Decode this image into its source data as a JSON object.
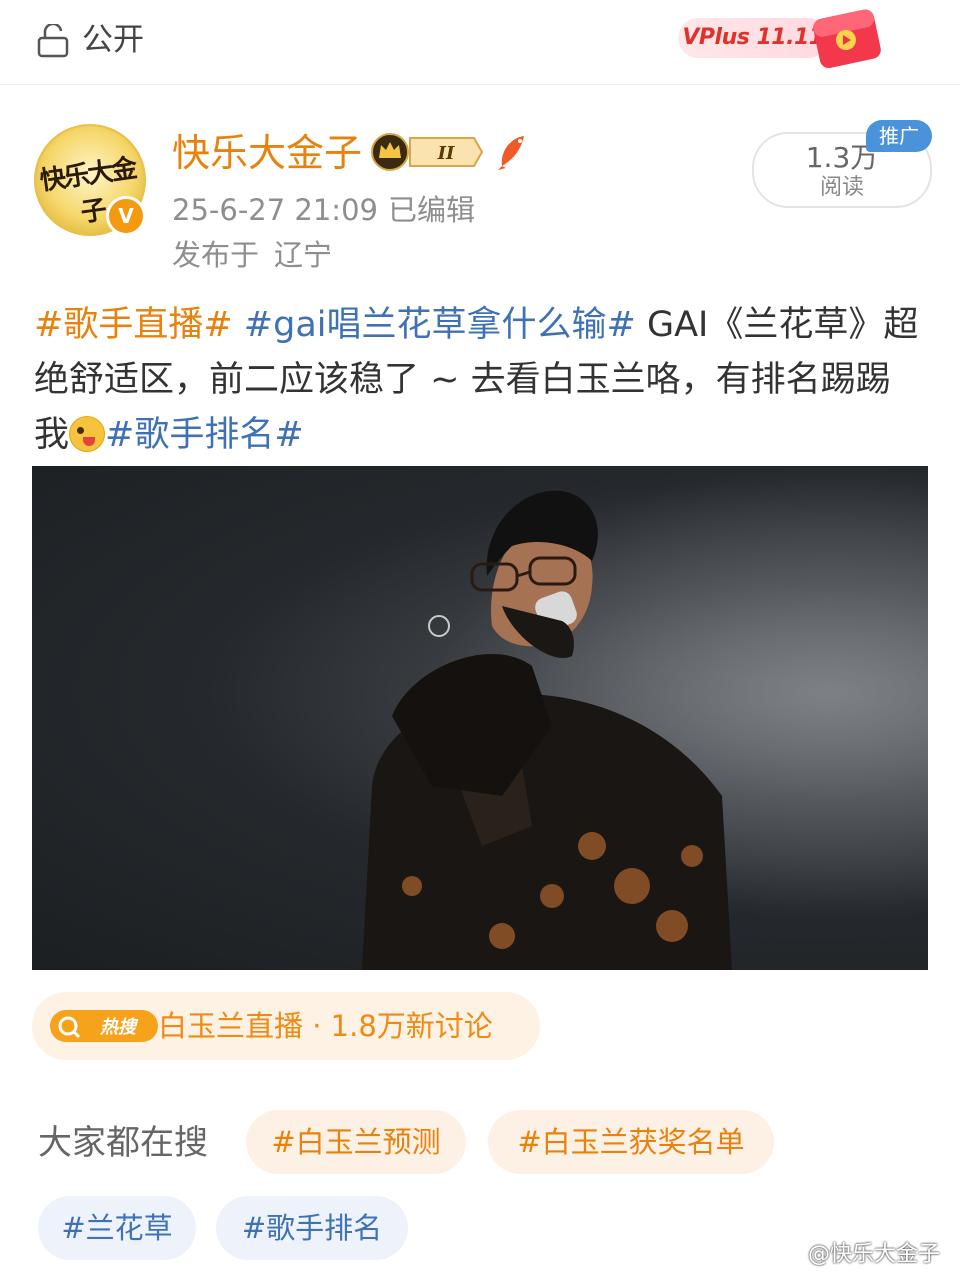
{
  "topbar": {
    "visibility_label": "公开",
    "promo_badge": "VPlus 11.11",
    "icons": [
      "lock-icon",
      "red-packet-icon"
    ]
  },
  "author": {
    "name": "快乐大金子",
    "avatar_text": "快乐大金子",
    "vip_level": "II",
    "verified_mark": "V",
    "post_time": "25-6-27 21:09",
    "edited_label": "已编辑",
    "location_prefix": "发布于",
    "location": "辽宁"
  },
  "reads": {
    "count": "1.3万",
    "label": "阅读",
    "promo_tag": "推广"
  },
  "post": {
    "hashtag1": "#歌手直播#",
    "hashtag2": "#gai唱兰花草拿什么输#",
    "text_main": " GAI《兰花草》超绝舒适区，前二应该稳了 ~ 去看白玉兰咯，有排名踢踢我",
    "hashtag3": "#歌手排名#"
  },
  "hot_search": {
    "badge": "热搜",
    "text": "白玉兰直播 · 1.8万新讨论"
  },
  "related_search": {
    "label": "大家都在搜",
    "chips": [
      "#白玉兰预测",
      "#白玉兰获奖名单",
      "#兰花草",
      "#歌手排名"
    ]
  },
  "watermark": "@快乐大金子",
  "colors": {
    "orange": "#e8820c",
    "blue": "#3f72b5",
    "grey_text": "#8e8e8e"
  }
}
